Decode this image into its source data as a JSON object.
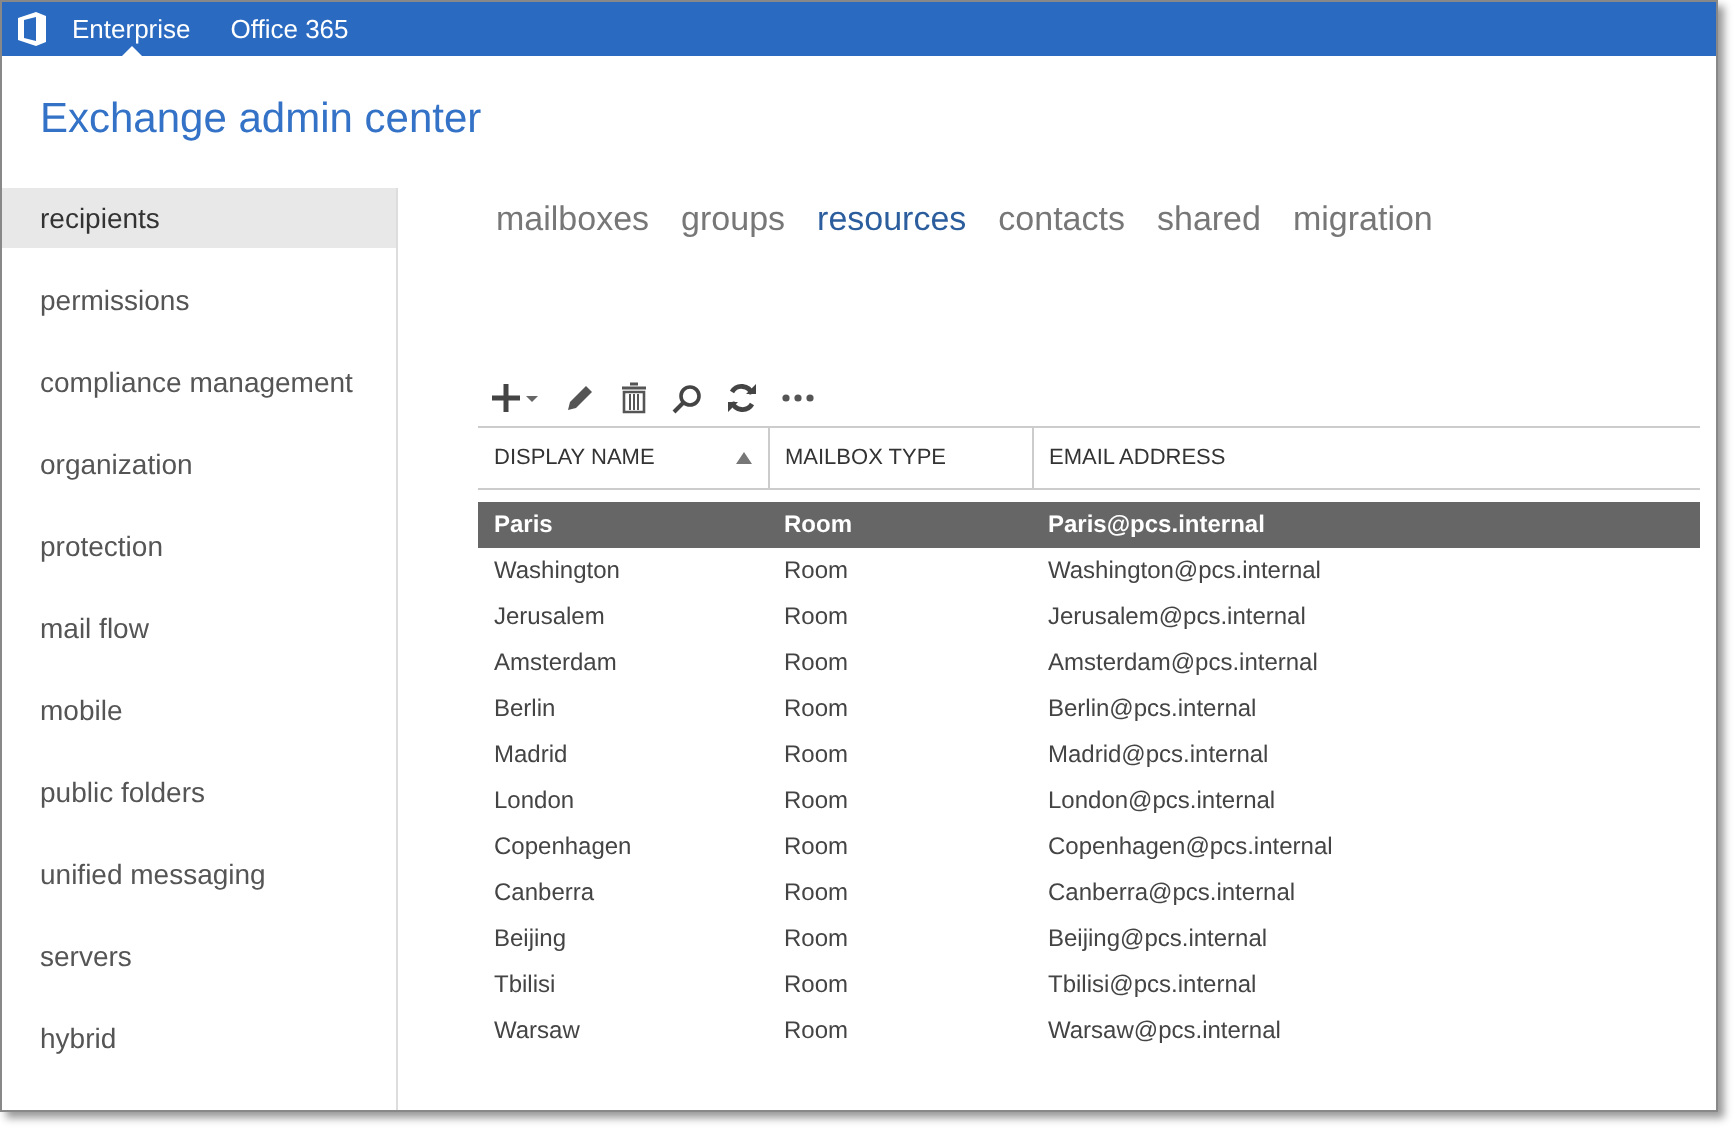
{
  "top_bar": {
    "items": [
      {
        "label": "Enterprise",
        "selected": true
      },
      {
        "label": "Office 365",
        "selected": false
      }
    ]
  },
  "title": "Exchange admin center",
  "sidebar": {
    "items": [
      {
        "label": "recipients",
        "selected": true
      },
      {
        "label": "permissions",
        "selected": false
      },
      {
        "label": "compliance management",
        "selected": false
      },
      {
        "label": "organization",
        "selected": false
      },
      {
        "label": "protection",
        "selected": false
      },
      {
        "label": "mail flow",
        "selected": false
      },
      {
        "label": "mobile",
        "selected": false
      },
      {
        "label": "public folders",
        "selected": false
      },
      {
        "label": "unified messaging",
        "selected": false
      },
      {
        "label": "servers",
        "selected": false
      },
      {
        "label": "hybrid",
        "selected": false
      }
    ]
  },
  "tabs": [
    {
      "label": "mailboxes",
      "selected": false
    },
    {
      "label": "groups",
      "selected": false
    },
    {
      "label": "resources",
      "selected": true
    },
    {
      "label": "contacts",
      "selected": false
    },
    {
      "label": "shared",
      "selected": false
    },
    {
      "label": "migration",
      "selected": false
    }
  ],
  "table": {
    "columns": [
      {
        "label": "DISPLAY NAME",
        "sorted": true
      },
      {
        "label": "MAILBOX TYPE",
        "sorted": false
      },
      {
        "label": "EMAIL ADDRESS",
        "sorted": false
      }
    ],
    "rows": [
      {
        "cells": [
          "Paris",
          "Room",
          "Paris@pcs.internal"
        ],
        "selected": true
      },
      {
        "cells": [
          "Washington",
          "Room",
          "Washington@pcs.internal"
        ],
        "selected": false
      },
      {
        "cells": [
          "Jerusalem",
          "Room",
          "Jerusalem@pcs.internal"
        ],
        "selected": false
      },
      {
        "cells": [
          "Amsterdam",
          "Room",
          "Amsterdam@pcs.internal"
        ],
        "selected": false
      },
      {
        "cells": [
          "Berlin",
          "Room",
          "Berlin@pcs.internal"
        ],
        "selected": false
      },
      {
        "cells": [
          "Madrid",
          "Room",
          "Madrid@pcs.internal"
        ],
        "selected": false
      },
      {
        "cells": [
          "London",
          "Room",
          "London@pcs.internal"
        ],
        "selected": false
      },
      {
        "cells": [
          "Copenhagen",
          "Room",
          "Copenhagen@pcs.internal"
        ],
        "selected": false
      },
      {
        "cells": [
          "Canberra",
          "Room",
          "Canberra@pcs.internal"
        ],
        "selected": false
      },
      {
        "cells": [
          "Beijing",
          "Room",
          "Beijing@pcs.internal"
        ],
        "selected": false
      },
      {
        "cells": [
          "Tbilisi",
          "Room",
          "Tbilisi@pcs.internal"
        ],
        "selected": false
      },
      {
        "cells": [
          "Warsaw",
          "Room",
          "Warsaw@pcs.internal"
        ],
        "selected": false
      }
    ]
  }
}
